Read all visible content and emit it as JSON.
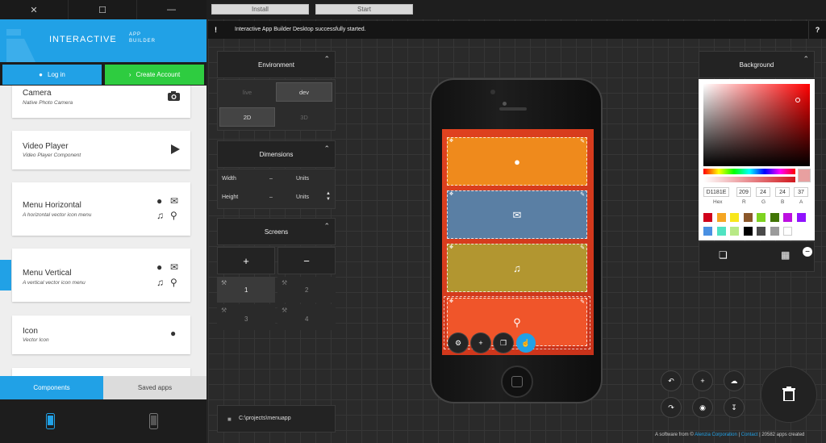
{
  "window": {
    "close": "✕",
    "maximize": "☐",
    "minimize": "—"
  },
  "header": {
    "brand": "INTERACTIVE",
    "brand_sub_1": "APP",
    "brand_sub_2": "BUILDER"
  },
  "auth": {
    "login": "Log in",
    "create": "Create Account"
  },
  "components": [
    {
      "title": "Camera",
      "sub": "Native Photo Camera"
    },
    {
      "title": "Video Player",
      "sub": "Video Player Component"
    },
    {
      "title": "Menu Horizontal",
      "sub": "A horizontal vector icon menu"
    },
    {
      "title": "Menu Vertical",
      "sub": "A vertical vector icon menu"
    },
    {
      "title": "Icon",
      "sub": "Vector Icon"
    }
  ],
  "tabs": {
    "components": "Components",
    "saved": "Saved apps"
  },
  "toolbar": {
    "install": "Install",
    "start": "Start"
  },
  "status": {
    "bang": "!",
    "message": "Interactive App Builder Desktop successfully started.",
    "help": "?"
  },
  "environment": {
    "title": "Environment",
    "live": "live",
    "dev": "dev",
    "d2": "2D",
    "d3": "3D"
  },
  "dimensions": {
    "title": "Dimensions",
    "width_label": "Width",
    "width_value": "–",
    "height_label": "Height",
    "height_value": "–",
    "units": "Units"
  },
  "screens": {
    "title": "Screens",
    "add": "+",
    "remove": "−",
    "items": [
      "1",
      "2",
      "3",
      "4"
    ]
  },
  "project": {
    "path": "C:\\projects\\menuapp"
  },
  "background": {
    "title": "Background",
    "hex": "D1181E",
    "r": "209",
    "g": "24",
    "b": "24",
    "a": "37",
    "labels": [
      "Hex",
      "R",
      "G",
      "B",
      "A"
    ],
    "swatches": [
      "#d0021b",
      "#f5a623",
      "#f8e71c",
      "#8b572a",
      "#7ed321",
      "#417505",
      "#bd10e0",
      "#9013fe",
      "#4a90e2",
      "#50e3c2",
      "#b8e986",
      "#000000",
      "#4a4a4a",
      "#9b9b9b",
      "#ffffff"
    ]
  },
  "footer": {
    "prefix": "A software from ©",
    "company": "Alenzia Corporation",
    "sep1": " | ",
    "contact": "Contact",
    "sep2": " | ",
    "count": "20582 apps created"
  },
  "colors": {
    "accent": "#21a1e6",
    "create": "#2ecc40",
    "tile1": "#ef8a1c",
    "tile2": "#5a7fa4",
    "tile3": "#b29630",
    "tile4": "#f0552a"
  }
}
